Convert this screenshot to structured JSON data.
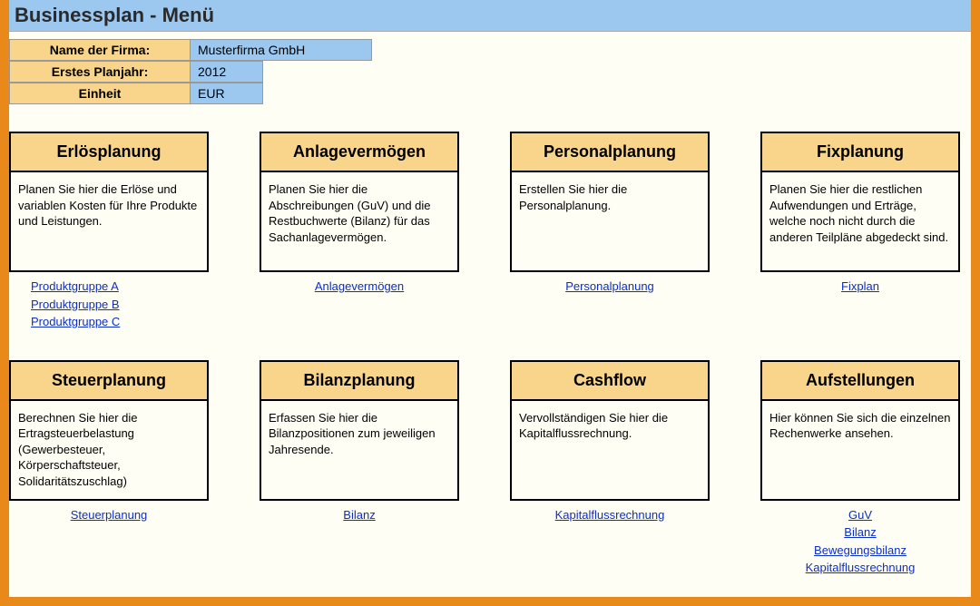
{
  "title": "Businessplan - Menü",
  "meta": {
    "row1_label": "Name der Firma:",
    "row1_value": "Musterfirma GmbH",
    "row2_label": "Erstes Planjahr:",
    "row2_value": "2012",
    "row3_label": "Einheit",
    "row3_value": "EUR"
  },
  "cards_top": [
    {
      "title": "Erlösplanung",
      "body": "Planen Sie hier die Erlöse und variablen Kosten für Ihre Produkte und Leistungen.",
      "links": [
        "Produktgruppe A",
        "Produktgruppe B",
        "Produktgruppe C"
      ]
    },
    {
      "title": "Anlagevermögen",
      "body": "Planen Sie hier die Abschreibungen (GuV) und die Restbuchwerte (Bilanz) für das Sachanlagevermögen.",
      "links": [
        "Anlagevermögen"
      ]
    },
    {
      "title": "Personalplanung",
      "body": "Erstellen Sie hier die Personalplanung.",
      "links": [
        "Personalplanung"
      ]
    },
    {
      "title": "Fixplanung",
      "body": "Planen Sie hier die restlichen Aufwendungen und Erträge, welche noch nicht durch die anderen Teilpläne abgedeckt sind.",
      "links": [
        "Fixplan"
      ]
    }
  ],
  "cards_bottom": [
    {
      "title": "Steuerplanung",
      "body": "Berechnen Sie hier die Ertragsteuerbelastung (Gewerbesteuer, Körperschaftsteuer, Solidaritätszuschlag)",
      "links": [
        "Steuerplanung"
      ]
    },
    {
      "title": "Bilanzplanung",
      "body": "Erfassen Sie hier die Bilanzpositionen zum jeweiligen Jahresende.",
      "links": [
        "Bilanz"
      ]
    },
    {
      "title": "Cashflow",
      "body": "Vervollständigen Sie hier die Kapitalflussrechnung.",
      "links": [
        "Kapitalflussrechnung"
      ]
    },
    {
      "title": "Aufstellungen",
      "body": "Hier können Sie sich die einzelnen Rechenwerke ansehen.",
      "links": [
        "GuV",
        "Bilanz",
        "Bewegungsbilanz",
        "Kapitalflussrechnung"
      ]
    }
  ]
}
